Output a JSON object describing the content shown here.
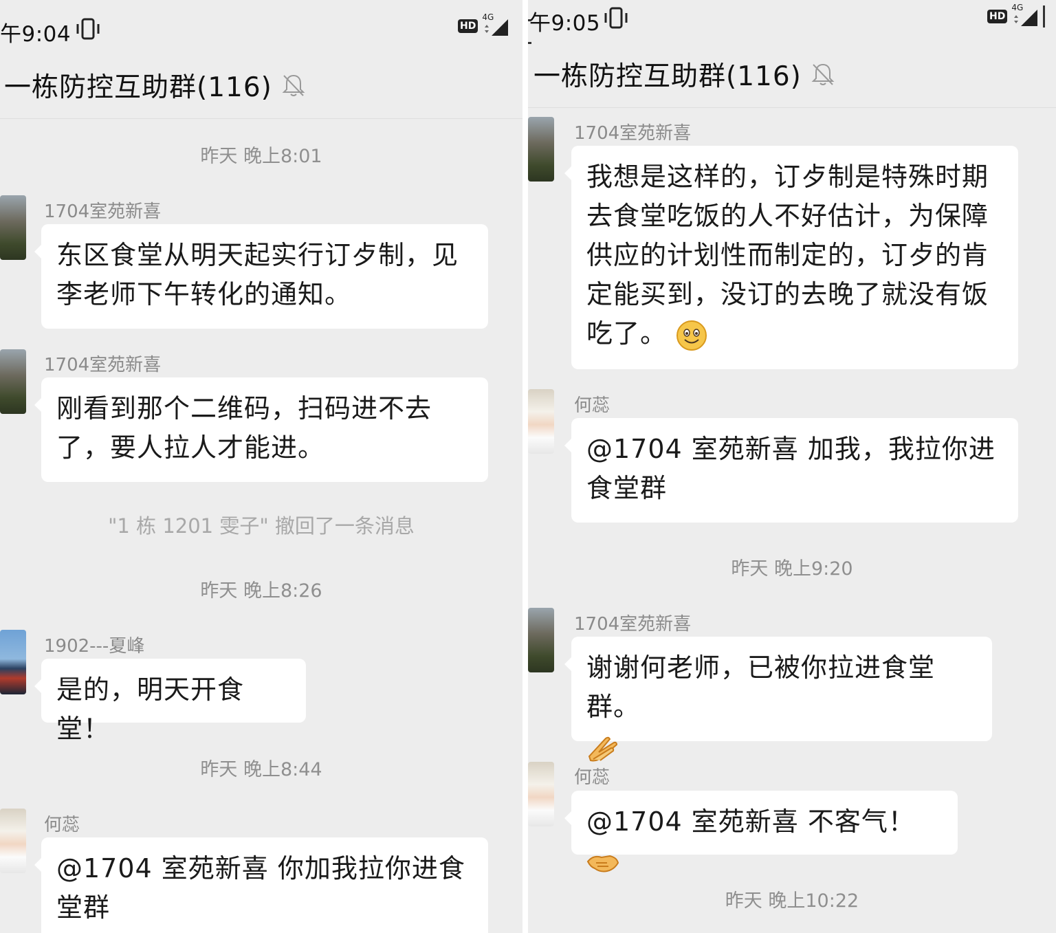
{
  "left": {
    "status": {
      "time": "午9:04",
      "hd": "HD",
      "network": "4G"
    },
    "title": "一栋防控互助群(116)",
    "items": {
      "t1": "昨天 晚上8:01",
      "m1": {
        "sender": "1704室苑新喜",
        "text": "东区食堂从明天起实行订歺制，见李老师下午转化的通知。"
      },
      "m2": {
        "sender": "1704室苑新喜",
        "text": "刚看到那个二维码，扫码进不去了，要人拉人才能进。"
      },
      "recall": "\"1 栋 1201 雯子\" 撤回了一条消息",
      "t2": "昨天 晚上8:26",
      "m3": {
        "sender": "1902---夏峰",
        "text": "是的，明天开食堂！"
      },
      "t3": "昨天 晚上8:44",
      "m4": {
        "sender": "何蕊",
        "text": "@1704 室苑新喜  你加我拉你进食堂群"
      }
    }
  },
  "right": {
    "status": {
      "time": "午9:05",
      "hd": "HD",
      "network": "4G"
    },
    "title": "一栋防控互助群(116)",
    "items": {
      "m1": {
        "sender": "1704室苑新喜",
        "text": "我想是这样的，订歺制是特殊时期去食堂吃饭的人不好估计，为保障供应的计划性而制定的，订歺的肯定能买到，没订的去晚了就没有饭吃了。",
        "emoji": "smile-emoji"
      },
      "m2": {
        "sender": "何蕊",
        "text": "@1704 室苑新喜  加我，我拉你进食堂群"
      },
      "t1": "昨天 晚上9:20",
      "m3": {
        "sender": "1704室苑新喜",
        "text": "谢谢何老师，已被你拉进食堂群。",
        "emoji": "clap-emoji"
      },
      "m4": {
        "sender": "何蕊",
        "text": "@1704 室苑新喜  不客气！",
        "emoji": "handshake-emoji"
      },
      "t2": "昨天 晚上10:22"
    }
  },
  "colors": {
    "background": "#ededed",
    "bubble": "#ffffff",
    "meta_text": "#8f8f8f"
  }
}
